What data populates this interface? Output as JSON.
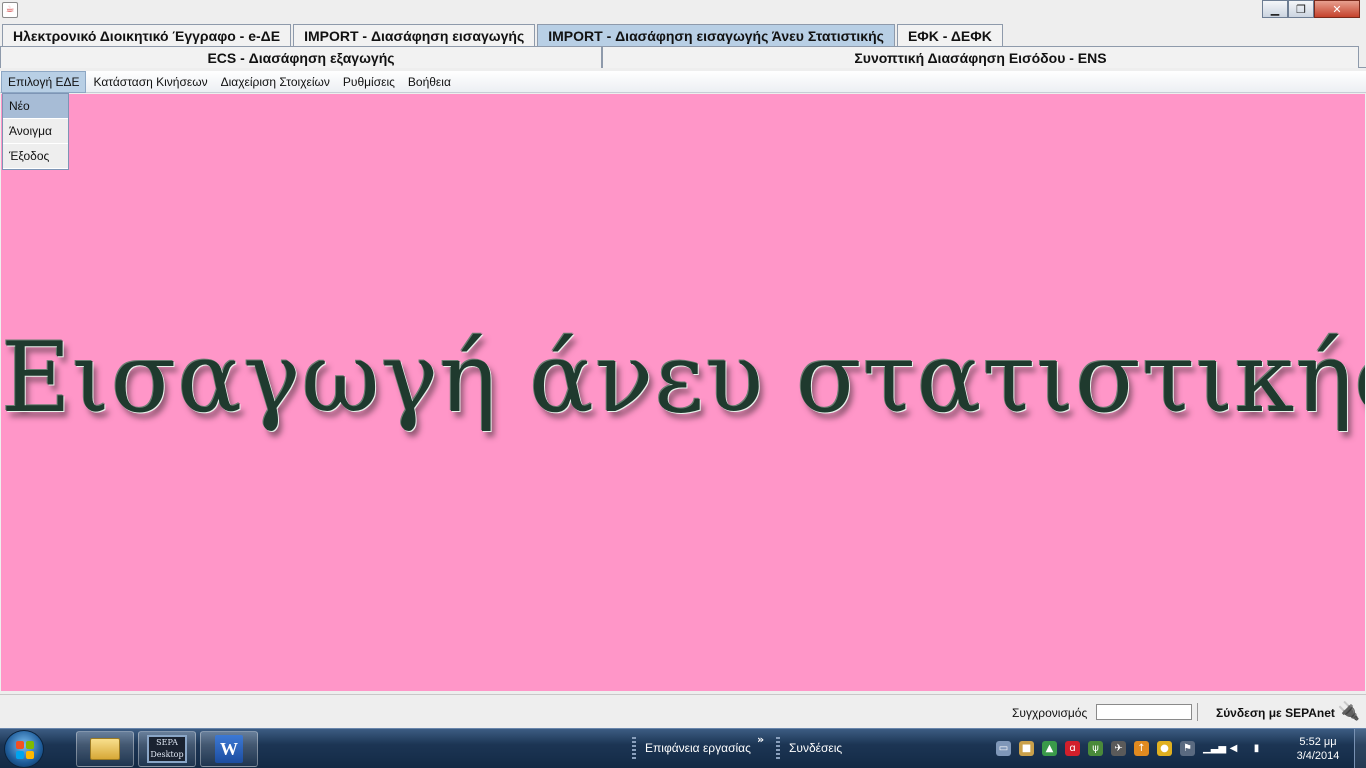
{
  "window": {
    "app_icon": "java-icon",
    "controls": [
      "minimize",
      "maximize",
      "close"
    ]
  },
  "tabs_row1": [
    {
      "label": "Ηλεκτρονικό Διοικητικό Έγγραφο - e-ΔΕ",
      "active": false
    },
    {
      "label": "IMPORT - Διασάφηση εισαγωγής",
      "active": false
    },
    {
      "label": "IMPORT - Διασάφηση εισαγωγής Άνευ Στατιστικής",
      "active": true
    },
    {
      "label": "ΕΦΚ - ΔΕΦΚ",
      "active": false
    }
  ],
  "tabs_row2": [
    {
      "label": "ECS - Διασάφηση εξαγωγής"
    },
    {
      "label": "Συνοπτική Διασάφηση Εισόδου - ENS"
    }
  ],
  "menubar": {
    "items": [
      "Επιλογή ΕΔΕ",
      "Κατάσταση Κινήσεων",
      "Διαχείριση Στοιχείων",
      "Ρυθμίσεις",
      "Βοήθεια"
    ],
    "active_index": 0
  },
  "dropdown": {
    "items": [
      "Νέο",
      "Άνοιγμα",
      "Έξοδος"
    ],
    "highlight_index": 0
  },
  "main": {
    "banner": "Εισαγωγή άνευ στατιστικής",
    "background": "#ff96c8"
  },
  "statusbar": {
    "sync_label": "Συγχρονισμός",
    "sync_progress": 0,
    "connection_label": "Σύνδεση με SEPAnet",
    "connection_icon": "disconnected-plug-icon"
  },
  "taskbar": {
    "pinned": [
      "windows-explorer-icon",
      "sepa-desktop-icon",
      "microsoft-word-icon"
    ],
    "sepa_text": "SEPA Desktop",
    "word_letter": "W",
    "toolbar_desktop": "Επιφάνεια εργασίας",
    "toolbar_connections": "Συνδέσεις",
    "clock_time": "5:52 μμ",
    "clock_date": "3/4/2014"
  }
}
